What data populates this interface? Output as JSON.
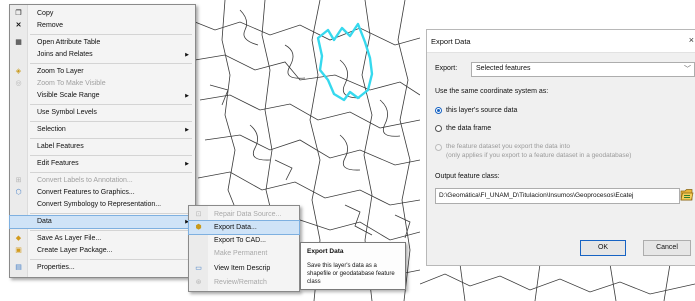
{
  "context_menu": {
    "items": [
      {
        "label": "Copy",
        "icon": "copy-icon"
      },
      {
        "label": "Remove",
        "icon": "remove-icon"
      },
      {
        "label": "Open Attribute Table",
        "icon": "table-icon"
      },
      {
        "label": "Joins and Relates",
        "submenu": true
      },
      {
        "label": "Zoom To Layer",
        "icon": "zoom-to-layer-icon"
      },
      {
        "label": "Zoom To Make Visible",
        "icon": "zoom-visible-icon",
        "disabled": true
      },
      {
        "label": "Visible Scale Range",
        "submenu": true
      },
      {
        "label": "Use Symbol Levels"
      },
      {
        "label": "Selection",
        "submenu": true
      },
      {
        "label": "Label Features"
      },
      {
        "label": "Edit Features",
        "submenu": true
      },
      {
        "label": "Convert Labels to Annotation...",
        "icon": "annotation-icon",
        "disabled": true
      },
      {
        "label": "Convert Features to Graphics...",
        "icon": "graphics-icon"
      },
      {
        "label": "Convert Symbology to Representation..."
      },
      {
        "label": "Data",
        "submenu": true,
        "highlighted": true
      },
      {
        "label": "Save As Layer File...",
        "icon": "layer-file-icon"
      },
      {
        "label": "Create Layer Package...",
        "icon": "layer-package-icon"
      },
      {
        "label": "Properties...",
        "icon": "properties-icon"
      }
    ]
  },
  "data_submenu": {
    "items": [
      {
        "label": "Repair Data Source...",
        "disabled": true,
        "icon": "repair-icon"
      },
      {
        "label": "Export Data...",
        "highlighted": true,
        "icon": "export-icon"
      },
      {
        "label": "Export To CAD...",
        "icon": "cad-icon"
      },
      {
        "label": "Make Permanent",
        "disabled": true
      },
      {
        "label": "View Item Descrip",
        "icon": "item-description-icon"
      },
      {
        "label": "Review/Rematch",
        "disabled": true,
        "icon": "rematch-icon"
      }
    ]
  },
  "tooltip": {
    "title": "Export Data",
    "body": "Save this layer's data as a shapefile or geodatabase feature class"
  },
  "dialog": {
    "title": "Export Data",
    "close_glyph": "×",
    "export_label": "Export:",
    "export_value": "Selected features",
    "coord_label": "Use the same coordinate system as:",
    "radio_source": "this layer's source data",
    "radio_frame": "the data frame",
    "radio_dataset_line1": "the feature dataset you export the data into",
    "radio_dataset_line2": "(only applies if you export to a feature dataset in a geodatabase)",
    "output_label": "Output feature class:",
    "output_path": "D:\\Geomática\\FI_UNAM_D\\Titulacion\\Insumos\\Geoprocesos\\Ecatej",
    "ok_label": "OK",
    "cancel_label": "Cancel"
  },
  "colors": {
    "selected_polygon": "#36d9ee",
    "menu_highlight": "#cfe3f7",
    "radio_accent": "#1763c3"
  }
}
